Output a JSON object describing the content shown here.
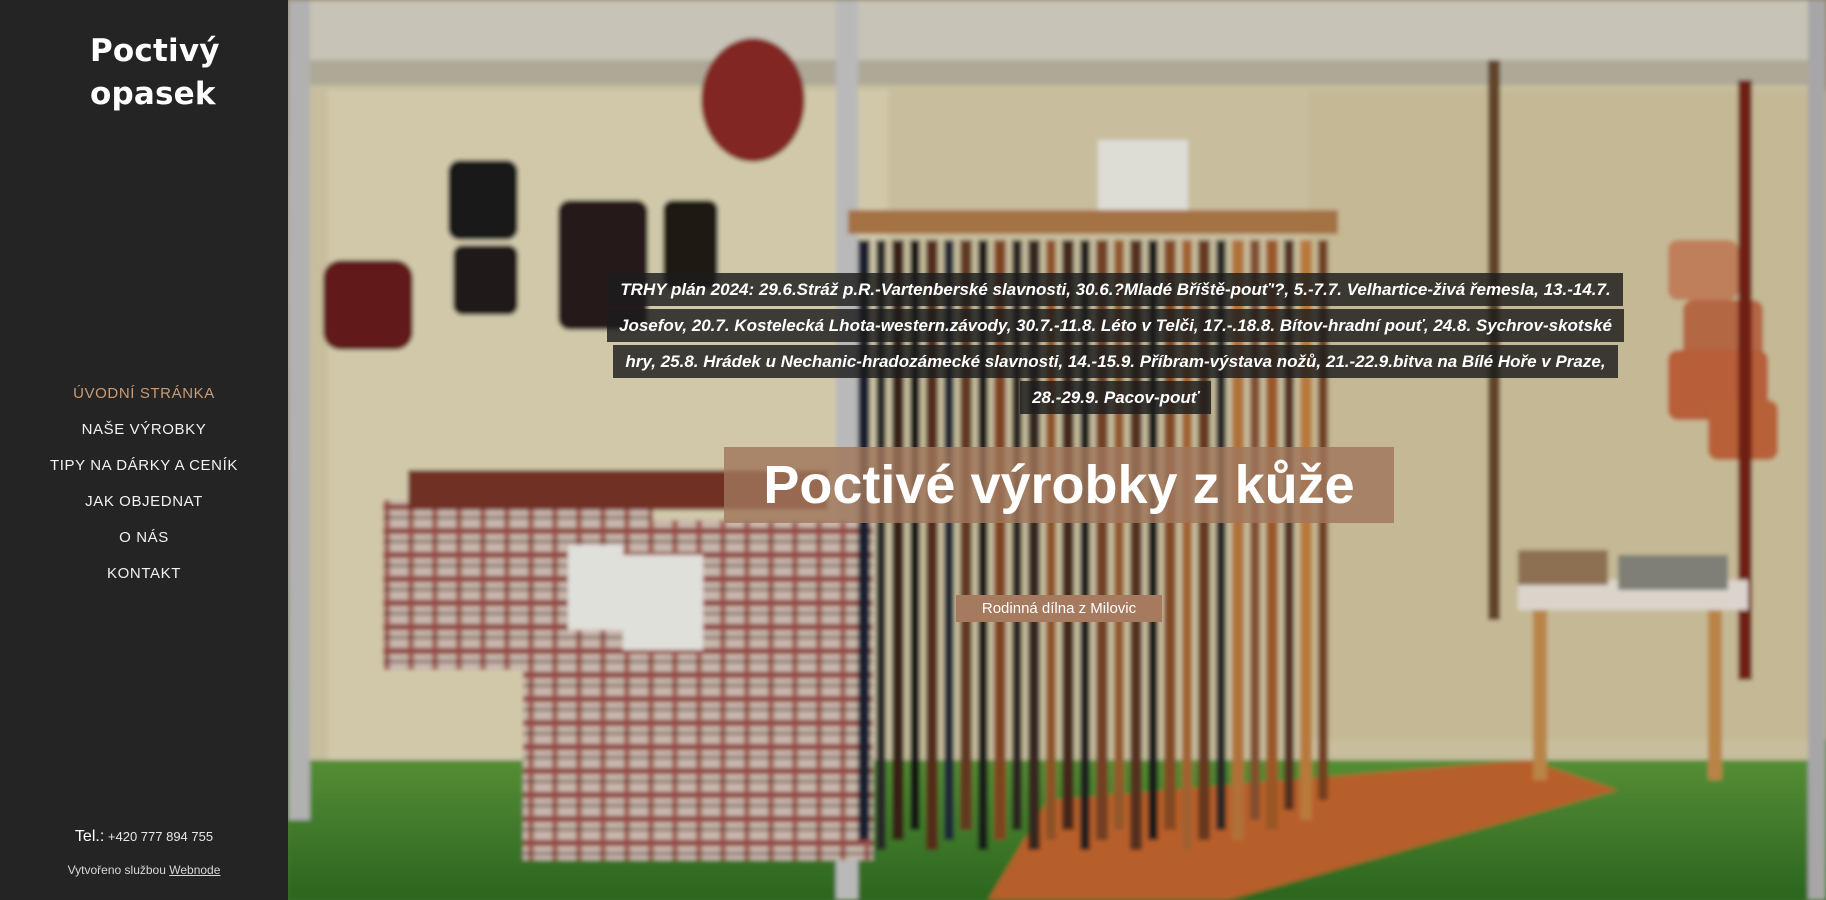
{
  "site": {
    "logo_line1": "Poctivý",
    "logo_line2": "opasek"
  },
  "nav": {
    "items": [
      {
        "label": "ÚVODNÍ STRÁNKA",
        "active": true
      },
      {
        "label": "NAŠE VÝROBKY"
      },
      {
        "label": "TIPY NA DÁRKY A CENÍK"
      },
      {
        "label": "JAK OBJEDNAT"
      },
      {
        "label": "O NÁS"
      },
      {
        "label": "KONTAKT"
      }
    ]
  },
  "contact": {
    "tel_label": "Tel.:",
    "tel_number": "+420 777 894 755"
  },
  "footer": {
    "credit_text": "Vytvořeno službou",
    "credit_link": "Webnode"
  },
  "hero": {
    "notice": "TRHY plán 2024:  29.6.Stráž p.R.-Vartenberské slavnosti, 30.6.?Mladé Bříště-pouť'?, 5.-7.7. Velhartice-živá řemesla, 13.-14.7. Josefov, 20.7. Kostelecká Lhota-western.závody,  30.7.-11.8. Léto v Telči, 17.-.18.8. Bítov-hradní pouť, 24.8. Sychrov-skotské hry, 25.8. Hrádek u Nechanic-hradozámecké slavnosti, 14.-15.9. Příbram-výstava nožů, 21.-22.9.bitva na Bílé Hoře v Praze, 28.-29.9. Pacov-pouť",
    "headline": "Poctivé výrobky z kůže",
    "subtitle": "Rodinná dílna z Milovic"
  },
  "colors": {
    "sidebar_bg": "#242424",
    "accent": "#c99b76",
    "headline_bg": "#a0765c",
    "subtitle_bg": "#a57a5e"
  }
}
